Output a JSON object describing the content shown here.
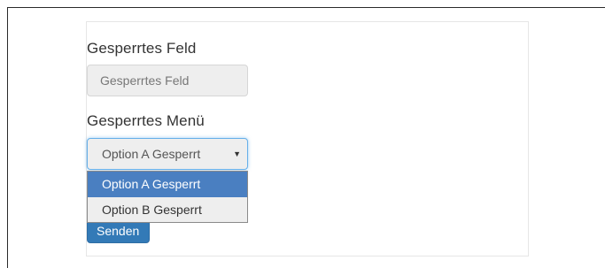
{
  "form": {
    "disabled_field": {
      "label": "Gesperrtes Feld",
      "placeholder": "Gesperrtes Feld"
    },
    "disabled_menu": {
      "label": "Gesperrtes Menü",
      "selected_value": "Option A Gesperrt",
      "arrow_icon": "caret-down-icon",
      "options": [
        {
          "label": "Option A Gesperrt",
          "highlighted": true
        },
        {
          "label": "Option B Gesperrt",
          "highlighted": false
        }
      ]
    },
    "submit_label": "Senden"
  },
  "colors": {
    "primary": "#337ab7",
    "option_highlight": "#4a7fc1",
    "focus_border": "#66afe9",
    "disabled_bg": "#eeeeee"
  }
}
